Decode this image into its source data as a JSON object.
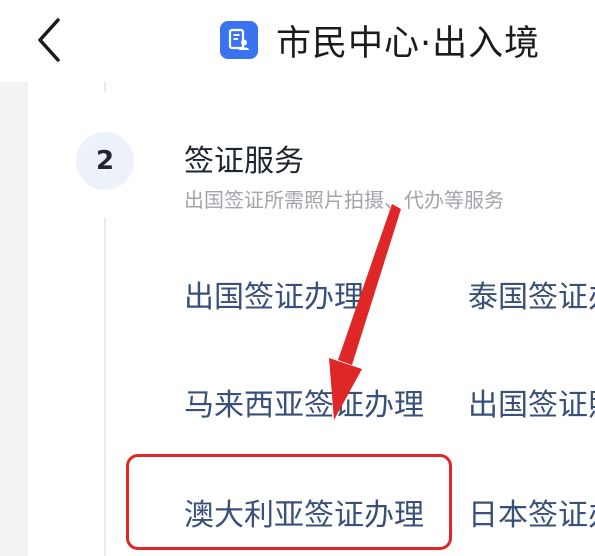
{
  "header": {
    "title": "市民中心·出入境",
    "icons": {
      "back": "chevron-left-icon",
      "app": "document-user-icon"
    },
    "colors": {
      "app_icon": "#3a73f0"
    }
  },
  "step": {
    "number": "2",
    "title": "签证服务",
    "subtitle": "出国签证所需照片拍摄、代办等服务"
  },
  "services": [
    {
      "label": "出国签证办理"
    },
    {
      "label": "泰国签证办"
    },
    {
      "label": "马来西亚签证办理"
    },
    {
      "label": "出国签证照"
    },
    {
      "label": "澳大利亚签证办理"
    },
    {
      "label": "日本签证办"
    }
  ],
  "annotation": {
    "color": "#e02727",
    "highlighted_item": "澳大利亚签证办理"
  }
}
